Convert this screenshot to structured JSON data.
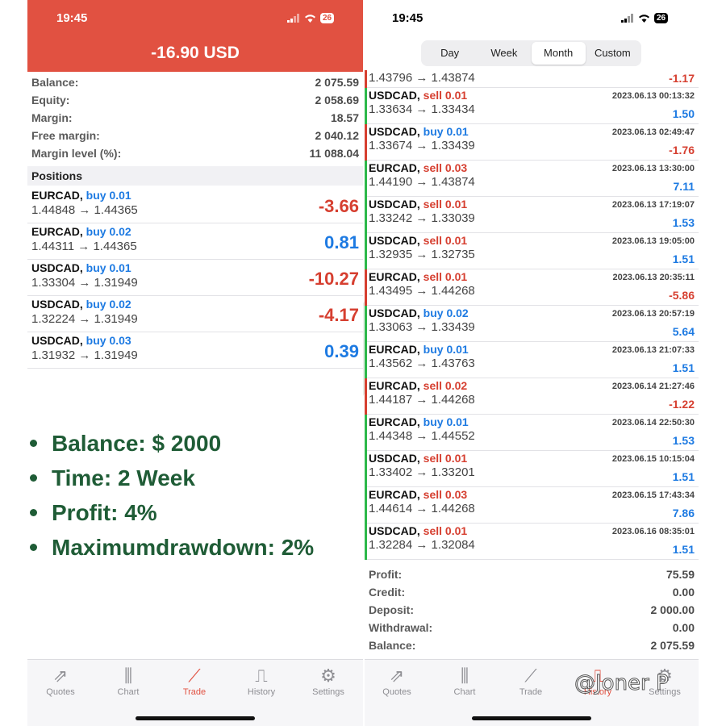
{
  "left": {
    "status": {
      "time": "19:45",
      "battery": "26"
    },
    "header_profit": "-16.90 USD",
    "account": [
      {
        "label": "Balance:",
        "value": "2 075.59"
      },
      {
        "label": "Equity:",
        "value": "2 058.69"
      },
      {
        "label": "Margin:",
        "value": "18.57"
      },
      {
        "label": "Free margin:",
        "value": "2 040.12"
      },
      {
        "label": "Margin level (%):",
        "value": "11 088.04"
      }
    ],
    "positions_title": "Positions",
    "positions": [
      {
        "symbol": "EURCAD,",
        "side": "buy 0.01",
        "prices": "1.44848 → 1.44365",
        "profit": "-3.66"
      },
      {
        "symbol": "EURCAD,",
        "side": "buy 0.02",
        "prices": "1.44311 → 1.44365",
        "profit": "0.81"
      },
      {
        "symbol": "USDCAD,",
        "side": "buy 0.01",
        "prices": "1.33304 → 1.31949",
        "profit": "-10.27"
      },
      {
        "symbol": "USDCAD,",
        "side": "buy 0.02",
        "prices": "1.32224 → 1.31949",
        "profit": "-4.17"
      },
      {
        "symbol": "USDCAD,",
        "side": "buy 0.03",
        "prices": "1.31932 → 1.31949",
        "profit": "0.39"
      }
    ],
    "bullets": [
      "Balance: $ 2000",
      "Time: 2 Week",
      "Profit: 4%",
      "Maximumdrawdown: 2%"
    ],
    "tabs": [
      {
        "label": "Quotes",
        "icon": "quotes-icon"
      },
      {
        "label": "Chart",
        "icon": "chart-icon"
      },
      {
        "label": "Trade",
        "icon": "trade-icon"
      },
      {
        "label": "History",
        "icon": "history-icon"
      },
      {
        "label": "Settings",
        "icon": "settings-icon"
      }
    ],
    "active_tab": "Trade"
  },
  "right": {
    "status": {
      "time": "19:45",
      "battery": "26"
    },
    "periods": [
      "Day",
      "Week",
      "Month",
      "Custom"
    ],
    "active_period": "Month",
    "top_partial": {
      "prices": "1.43796 → 1.43874",
      "amount": "-1.17"
    },
    "deals": [
      {
        "symbol": "USDCAD,",
        "side": "sell 0.01",
        "time": "2023.06.13 00:13:32",
        "prices": "1.33634 → 1.33434",
        "amount": "1.50"
      },
      {
        "symbol": "USDCAD,",
        "side": "buy 0.01",
        "time": "2023.06.13 02:49:47",
        "prices": "1.33674 → 1.33439",
        "amount": "-1.76"
      },
      {
        "symbol": "EURCAD,",
        "side": "sell 0.03",
        "time": "2023.06.13 13:30:00",
        "prices": "1.44190 → 1.43874",
        "amount": "7.11"
      },
      {
        "symbol": "USDCAD,",
        "side": "sell 0.01",
        "time": "2023.06.13 17:19:07",
        "prices": "1.33242 → 1.33039",
        "amount": "1.53"
      },
      {
        "symbol": "USDCAD,",
        "side": "sell 0.01",
        "time": "2023.06.13 19:05:00",
        "prices": "1.32935 → 1.32735",
        "amount": "1.51"
      },
      {
        "symbol": "EURCAD,",
        "side": "sell 0.01",
        "time": "2023.06.13 20:35:11",
        "prices": "1.43495 → 1.44268",
        "amount": "-5.86"
      },
      {
        "symbol": "USDCAD,",
        "side": "buy 0.02",
        "time": "2023.06.13 20:57:19",
        "prices": "1.33063 → 1.33439",
        "amount": "5.64"
      },
      {
        "symbol": "EURCAD,",
        "side": "buy 0.01",
        "time": "2023.06.13 21:07:33",
        "prices": "1.43562 → 1.43763",
        "amount": "1.51"
      },
      {
        "symbol": "EURCAD,",
        "side": "sell 0.02",
        "time": "2023.06.14 21:27:46",
        "prices": "1.44187 → 1.44268",
        "amount": "-1.22"
      },
      {
        "symbol": "EURCAD,",
        "side": "buy 0.01",
        "time": "2023.06.14 22:50:30",
        "prices": "1.44348 → 1.44552",
        "amount": "1.53"
      },
      {
        "symbol": "USDCAD,",
        "side": "sell 0.01",
        "time": "2023.06.15 10:15:04",
        "prices": "1.33402 → 1.33201",
        "amount": "1.51"
      },
      {
        "symbol": "EURCAD,",
        "side": "sell 0.03",
        "time": "2023.06.15 17:43:34",
        "prices": "1.44614 → 1.44268",
        "amount": "7.86"
      },
      {
        "symbol": "USDCAD,",
        "side": "sell 0.01",
        "time": "2023.06.16 08:35:01",
        "prices": "1.32284 → 1.32084",
        "amount": "1.51"
      }
    ],
    "summary": [
      {
        "label": "Profit:",
        "value": "75.59"
      },
      {
        "label": "Credit:",
        "value": "0.00"
      },
      {
        "label": "Deposit:",
        "value": "2 000.00"
      },
      {
        "label": "Withdrawal:",
        "value": "0.00"
      },
      {
        "label": "Balance:",
        "value": "2 075.59"
      }
    ],
    "tabs": [
      {
        "label": "Quotes",
        "icon": "quotes-icon"
      },
      {
        "label": "Chart",
        "icon": "chart-icon"
      },
      {
        "label": "Trade",
        "icon": "trade-icon"
      },
      {
        "label": "History",
        "icon": "history-icon"
      },
      {
        "label": "Settings",
        "icon": "settings-icon"
      }
    ],
    "active_tab": "History"
  },
  "watermark": "@Joner P",
  "colors": {
    "header_red": "#e15141",
    "buy_blue": "#1d7ae2",
    "sell_red": "#d63f30",
    "bullet_green": "#1f5c36",
    "profit_bar_green": "#2db84a"
  }
}
